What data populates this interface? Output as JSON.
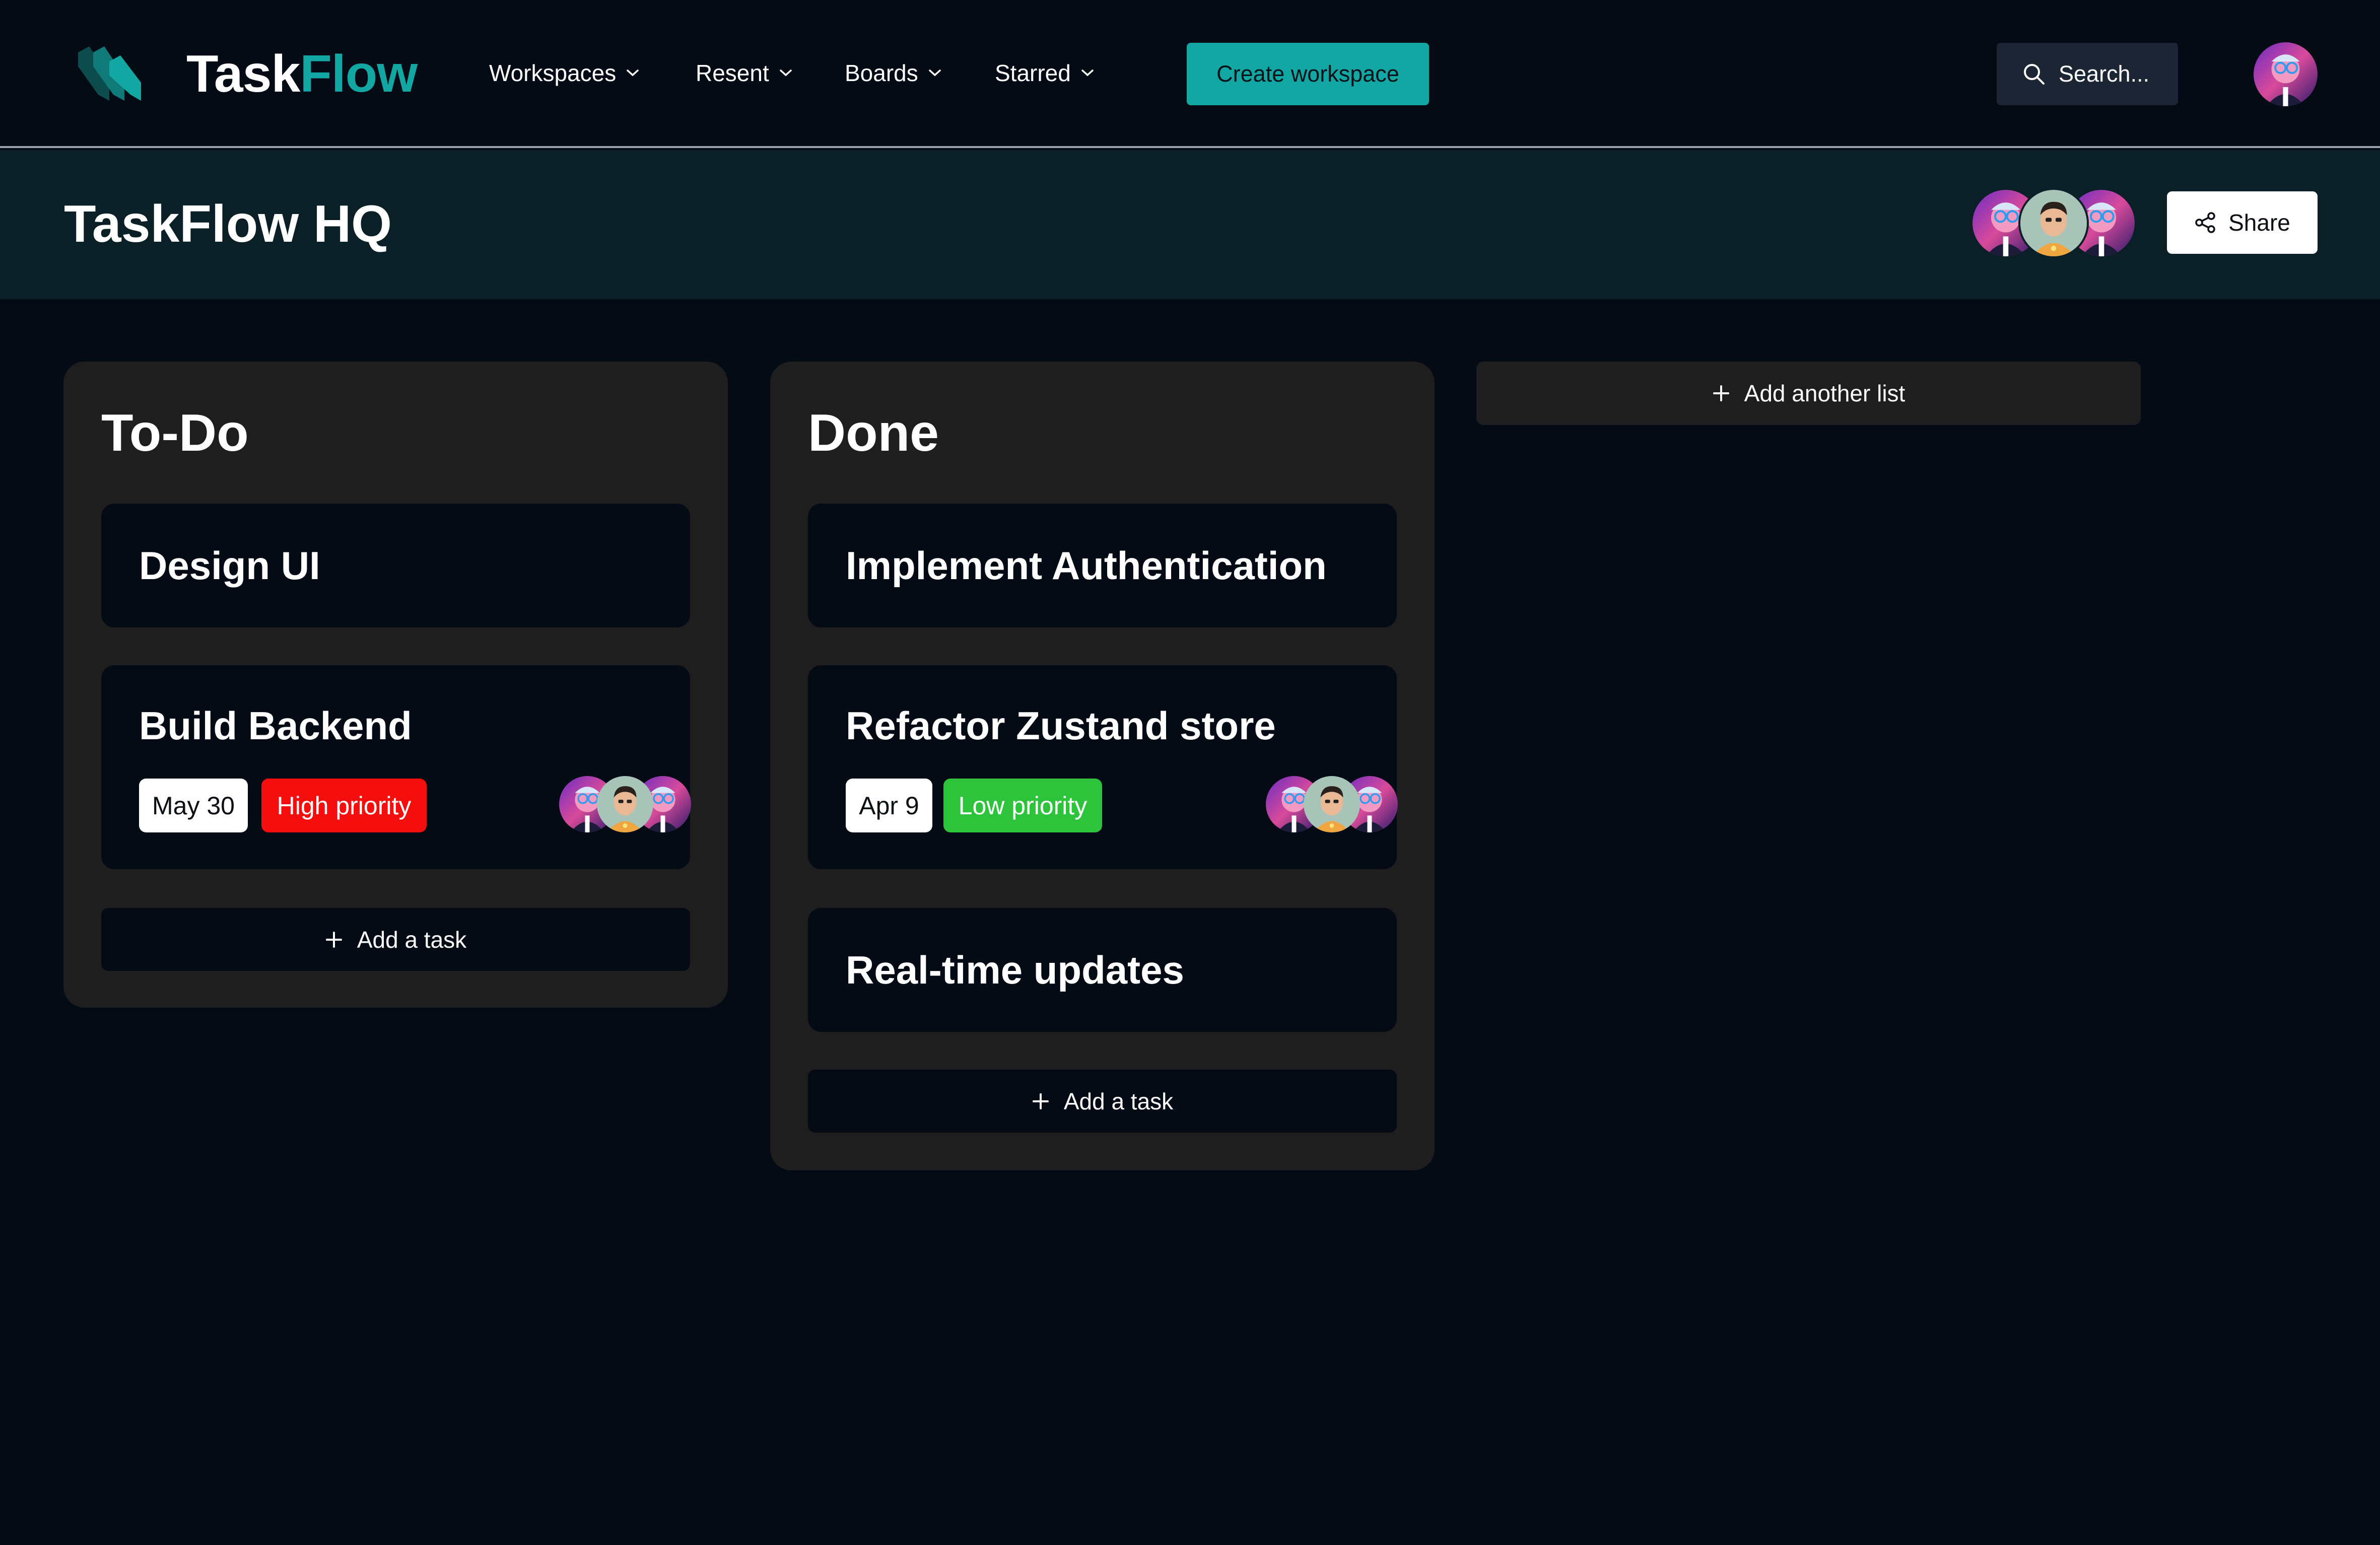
{
  "brand": {
    "name_part1": "Task",
    "name_part2": "Flow",
    "accent_color": "#12a7a3"
  },
  "nav": {
    "items": [
      {
        "label": "Workspaces",
        "icon": "chevron-down-icon"
      },
      {
        "label": "Resent",
        "icon": "chevron-down-icon"
      },
      {
        "label": "Boards",
        "icon": "chevron-down-icon"
      },
      {
        "label": "Starred",
        "icon": "chevron-down-icon"
      }
    ],
    "create_label": "Create workspace",
    "search_placeholder": "Search...",
    "user_avatar": "user-avatar"
  },
  "board": {
    "title": "TaskFlow HQ",
    "members": [
      "member-avatar-1",
      "member-avatar-2",
      "member-avatar-3"
    ],
    "share_label": "Share",
    "share_icon": "share-icon"
  },
  "lists": [
    {
      "title": "To-Do",
      "cards": [
        {
          "title": "Design UI"
        },
        {
          "title": "Build Backend",
          "date": "May 30",
          "priority": "High priority",
          "priority_color": "#f40e0e"
        }
      ],
      "add_task_label": "Add a task"
    },
    {
      "title": "Done",
      "cards": [
        {
          "title": "Implement Authentication"
        },
        {
          "title": "Refactor Zustand store",
          "date": "Apr 9",
          "priority": "Low priority",
          "priority_color": "#2dc33b"
        },
        {
          "title": "Real-time updates"
        }
      ],
      "add_task_label": "Add a task"
    }
  ],
  "add_list_label": "Add another list",
  "colors": {
    "background": "#040b14",
    "header_band": "#0b1f26",
    "list_bg": "#1e1e1e"
  }
}
